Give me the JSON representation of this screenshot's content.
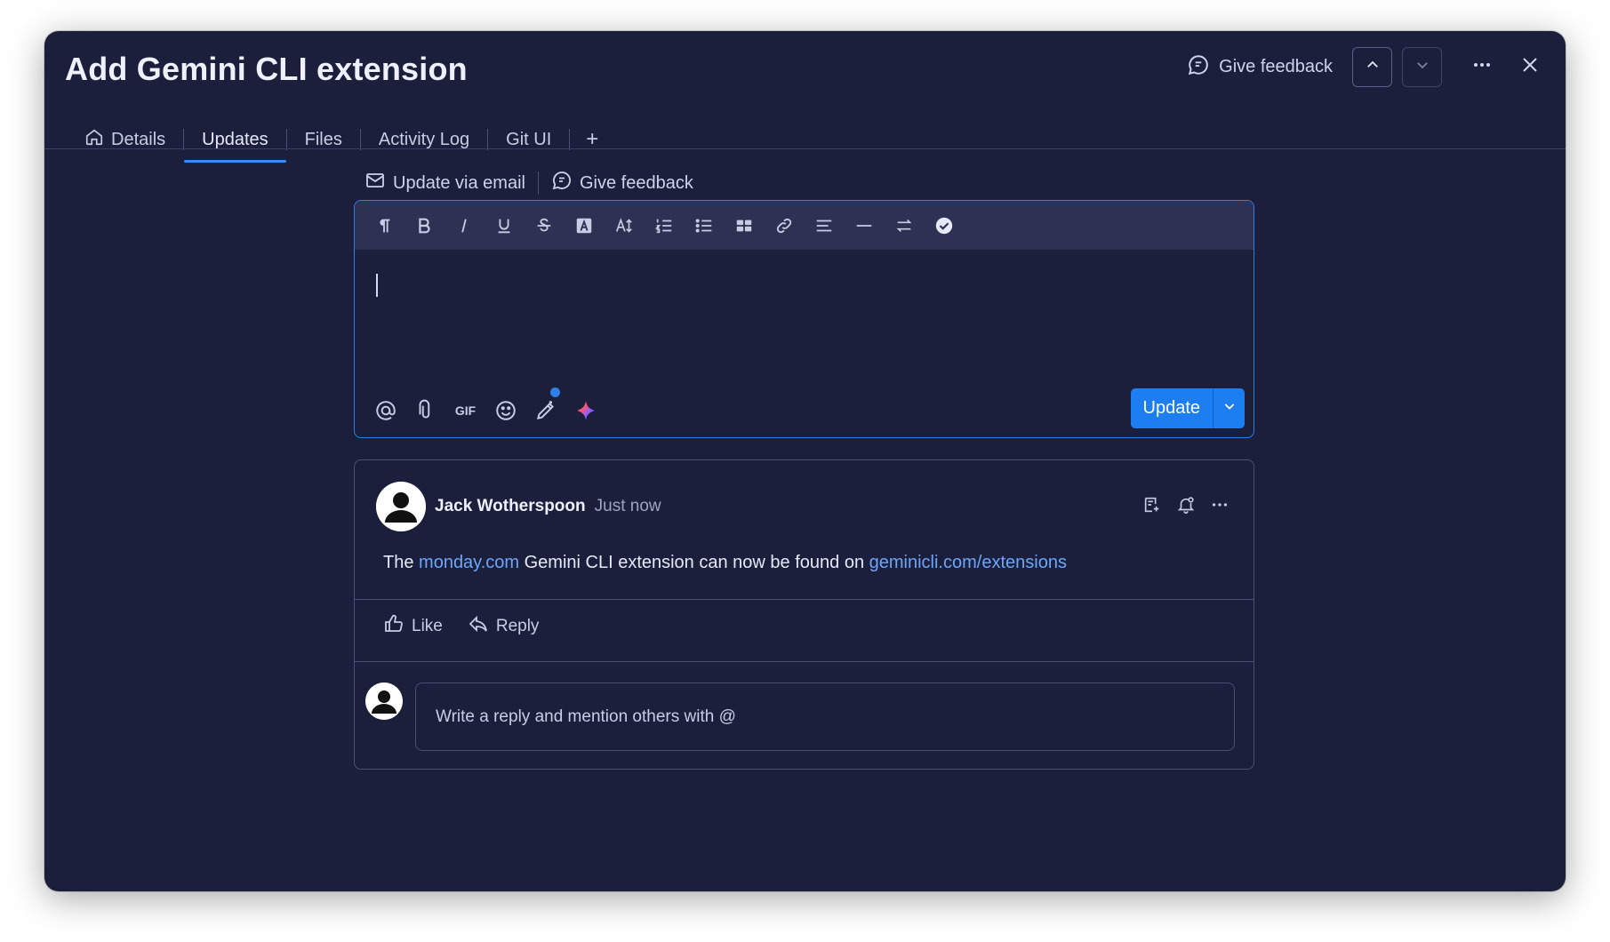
{
  "window": {
    "title": "Add Gemini CLI extension"
  },
  "top_actions": {
    "give_feedback": "Give feedback"
  },
  "tabs": [
    {
      "label": "Details",
      "icon": "home-icon"
    },
    {
      "label": "Updates"
    },
    {
      "label": "Files"
    },
    {
      "label": "Activity Log"
    },
    {
      "label": "Git UI"
    },
    {
      "label": "+"
    }
  ],
  "subbar": {
    "update_via_email": "Update via email",
    "give_feedback": "Give feedback"
  },
  "editor": {
    "toolbar_icons": [
      "paragraph-icon",
      "bold-icon",
      "italic-icon",
      "underline-icon",
      "strikethrough-icon",
      "text-color-icon",
      "font-size-icon",
      "numbered-list-icon",
      "bullet-list-icon",
      "table-icon",
      "link-icon",
      "align-icon",
      "divider-icon",
      "text-direction-icon",
      "checklist-icon"
    ],
    "bottom_icons": [
      "mention-icon",
      "attach-icon",
      "gif-icon",
      "emoji-icon",
      "draw-icon",
      "ai-sparkle-icon"
    ],
    "gif_label": "GIF",
    "update_label": "Update",
    "accent": "#1c7ef0"
  },
  "post": {
    "author": "Jack Wotherspoon",
    "time": "Just now",
    "body_prefix": "The ",
    "link1": "monday.com",
    "body_middle": " Gemini CLI extension can now be found on ",
    "link2": "geminicli.com/extensions",
    "like_label": "Like",
    "reply_label": "Reply",
    "reply_placeholder": "Write a reply and mention others with @",
    "link_color": "#6ea6f7"
  }
}
